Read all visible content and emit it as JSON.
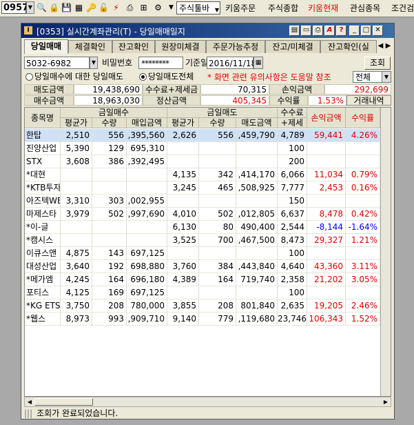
{
  "toolbar": {
    "stock_code": "0957",
    "menu_toolbar": "주식툴바",
    "menus": [
      "키움주문",
      "주식종합",
      "키움현재",
      "관심종목",
      "조건검"
    ],
    "menu_colors": [
      "#000000",
      "#000000",
      "#e00000",
      "#000000",
      "#000000"
    ]
  },
  "window": {
    "title": "[0353] 실시간계좌관리(T) - 당일매매일지",
    "icon_letter": "I"
  },
  "tabs": [
    "당일매매",
    "체결확인",
    "잔고확인",
    "원장미체결",
    "주문가능추정",
    "잔고/미체결",
    "잔고확인(실"
  ],
  "form": {
    "account": "5032-6982",
    "password_label": "비밀번호",
    "password_value": "********",
    "date_label": "기준일",
    "date_value": "2016/11/18",
    "query_button": "조회",
    "radio1": "당일매수에 대한 당일매도",
    "radio2": "당일매도전체",
    "warning": "* 화면 관련 유의사항은 도움말 참조",
    "filter_value": "전체"
  },
  "summary": {
    "sell_amount_label": "매도금액",
    "sell_amount": "19,438,690",
    "fee_tax_label": "수수료+제세금",
    "fee_tax": "70,315",
    "pl_label": "손익금액",
    "pl_amount": "292,699",
    "buy_amount_label": "매수금액",
    "buy_amount": "18,963,030",
    "settle_label": "정산금액",
    "settle_amount": "405,345",
    "return_label": "수익률",
    "return_value": "1.53%",
    "history_label": "거래내역"
  },
  "grid": {
    "h_name": "종목명",
    "h_buy_group": "금일매수",
    "h_sell_group": "금일매도",
    "h_fee": "수수료",
    "h_fee2": "+제세금",
    "h_pl": "손익금액",
    "h_ret": "수익률",
    "h_sub": [
      "평균가",
      "수량",
      "매입금액",
      "평균가",
      "수량",
      "매도금액"
    ],
    "rows": [
      {
        "name": "한탑",
        "bp": "2,510",
        "bq": "556",
        "ba": ",395,560",
        "sp": "2,626",
        "sq": "556",
        "sa": ",459,790",
        "fee": "4,789",
        "pl": "59,441",
        "ret": "4.26%",
        "cls": "red",
        "sel": true
      },
      {
        "name": "진양산업",
        "bp": "5,390",
        "bq": "129",
        "ba": "695,310",
        "sp": "",
        "sq": "",
        "sa": "",
        "fee": "100",
        "pl": "",
        "ret": "",
        "cls": ""
      },
      {
        "name": "STX",
        "bp": "3,608",
        "bq": "386",
        "ba": ",392,495",
        "sp": "",
        "sq": "",
        "sa": "",
        "fee": "200",
        "pl": "",
        "ret": "",
        "cls": ""
      },
      {
        "name": "*대현",
        "bp": "",
        "bq": "",
        "ba": "",
        "sp": "4,135",
        "sq": "342",
        "sa": ",414,170",
        "fee": "6,066",
        "pl": "11,034",
        "ret": "0.79%",
        "cls": "red"
      },
      {
        "name": "*KTB투자",
        "bp": "",
        "bq": "",
        "ba": "",
        "sp": "3,245",
        "sq": "465",
        "sa": ",508,925",
        "fee": "7,777",
        "pl": "2,453",
        "ret": "0.16%",
        "cls": "red"
      },
      {
        "name": "아즈텍WB",
        "bp": "3,310",
        "bq": "303",
        "ba": ",002,955",
        "sp": "",
        "sq": "",
        "sa": "",
        "fee": "150",
        "pl": "",
        "ret": "",
        "cls": ""
      },
      {
        "name": "마제스타",
        "bp": "3,979",
        "bq": "502",
        "ba": ",997,690",
        "sp": "4,010",
        "sq": "502",
        "sa": ",012,805",
        "fee": "6,637",
        "pl": "8,478",
        "ret": "0.42%",
        "cls": "red"
      },
      {
        "name": "*이-글",
        "bp": "",
        "bq": "",
        "ba": "",
        "sp": "6,130",
        "sq": "80",
        "sa": "490,400",
        "fee": "2,544",
        "pl": "-8,144",
        "ret": "-1.64%",
        "cls": "blue"
      },
      {
        "name": "*캠시스",
        "bp": "",
        "bq": "",
        "ba": "",
        "sp": "3,525",
        "sq": "700",
        "sa": ",467,500",
        "fee": "8,473",
        "pl": "29,327",
        "ret": "1.21%",
        "cls": "red"
      },
      {
        "name": "이큐스앤",
        "bp": "4,875",
        "bq": "143",
        "ba": "697,125",
        "sp": "",
        "sq": "",
        "sa": "",
        "fee": "100",
        "pl": "",
        "ret": "",
        "cls": ""
      },
      {
        "name": "대성산업",
        "bp": "3,640",
        "bq": "192",
        "ba": "698,880",
        "sp": "3,760",
        "sq": "384",
        "sa": ",443,840",
        "fee": "4,640",
        "pl": "43,360",
        "ret": "3.11%",
        "cls": "red"
      },
      {
        "name": "*메가엠",
        "bp": "4,245",
        "bq": "164",
        "ba": "696,180",
        "sp": "4,389",
        "sq": "164",
        "sa": "719,740",
        "fee": "2,358",
        "pl": "21,202",
        "ret": "3.05%",
        "cls": "red"
      },
      {
        "name": "포티스",
        "bp": "4,125",
        "bq": "169",
        "ba": "697,125",
        "sp": "",
        "sq": "",
        "sa": "",
        "fee": "100",
        "pl": "",
        "ret": "",
        "cls": ""
      },
      {
        "name": "*KG ETS",
        "bp": "3,750",
        "bq": "208",
        "ba": "780,000",
        "sp": "3,855",
        "sq": "208",
        "sa": "801,840",
        "fee": "2,635",
        "pl": "19,205",
        "ret": "2.46%",
        "cls": "red"
      },
      {
        "name": "*웹스",
        "bp": "8,973",
        "bq": "993",
        "ba": ",909,710",
        "sp": "9,140",
        "sq": "779",
        "sa": ",119,680",
        "fee": "23,746",
        "pl": "106,343",
        "ret": "1.52%",
        "cls": "red"
      }
    ]
  },
  "status": {
    "message": "조회가 완료되었습니다."
  }
}
